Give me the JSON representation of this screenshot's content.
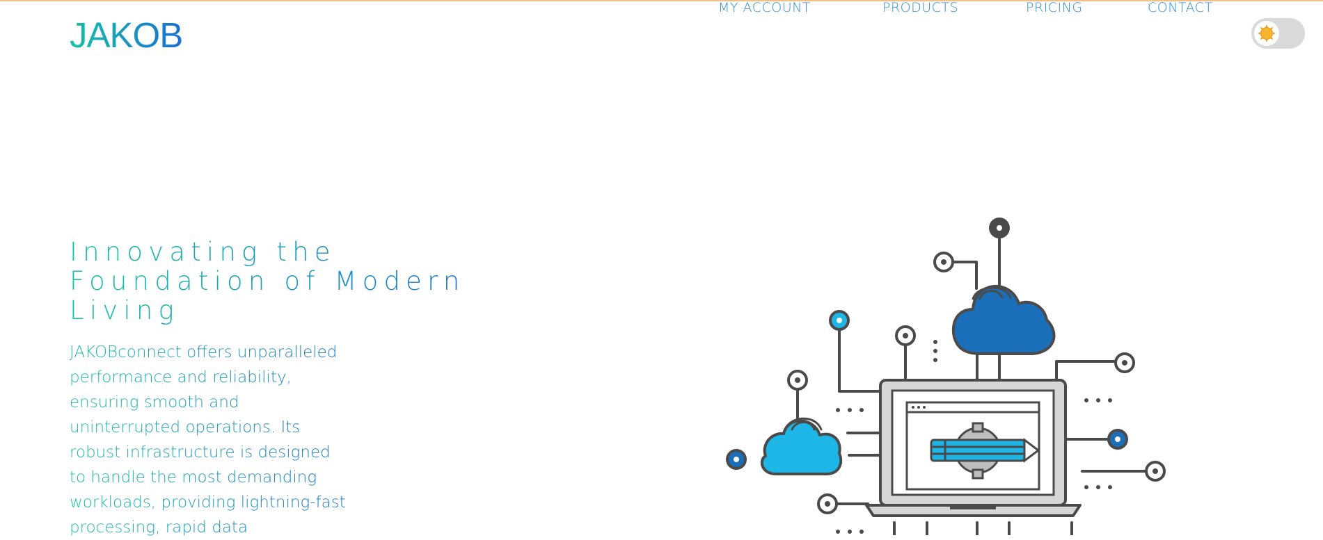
{
  "header": {
    "logo": "JAKOB",
    "nav": [
      {
        "label": "MY ACCOUNT"
      },
      {
        "label": "PRODUCTS"
      },
      {
        "label": "PRICING"
      },
      {
        "label": "CONTACT"
      }
    ],
    "theme_toggle": {
      "icon": "sun-icon",
      "state": "light"
    }
  },
  "hero": {
    "headline": "Innovating the Foundation of Modern Living",
    "body": "JAKOBconnect offers unparalleled performance and reliability, ensuring smooth and uninterrupted operations. Its robust infrastructure is designed to handle the most demanding workloads, providing lightning-fast processing, rapid data",
    "illustration": "cloud-network-laptop-illustration"
  },
  "colors": {
    "gradient_start": "#16c2a5",
    "gradient_end": "#1a6fd6",
    "nav_text": "#2f8fd2",
    "toggle_track": "#d9d9d9",
    "sun": "#f6b52c",
    "top_accent": "#f1c18c",
    "cloud_dark": "#1b6fba",
    "cloud_light": "#1eb6e6",
    "line_gray": "#4a4a4a"
  }
}
